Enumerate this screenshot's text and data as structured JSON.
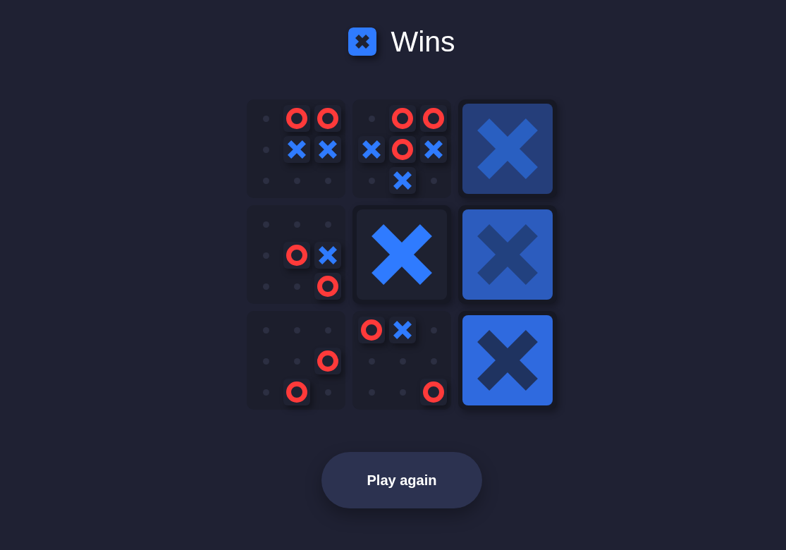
{
  "header": {
    "logo": {
      "kind": "x"
    },
    "title": "Wins"
  },
  "board": {
    "sub_boards": [
      {
        "kind": "open",
        "cells": [
          {
            "kind": "empty"
          },
          {
            "kind": "o"
          },
          {
            "kind": "o"
          },
          {
            "kind": "empty"
          },
          {
            "kind": "x"
          },
          {
            "kind": "x"
          },
          {
            "kind": "empty"
          },
          {
            "kind": "empty"
          },
          {
            "kind": "empty"
          }
        ]
      },
      {
        "kind": "open",
        "cells": [
          {
            "kind": "empty"
          },
          {
            "kind": "o"
          },
          {
            "kind": "o"
          },
          {
            "kind": "x"
          },
          {
            "kind": "o"
          },
          {
            "kind": "x"
          },
          {
            "kind": "empty"
          },
          {
            "kind": "x"
          },
          {
            "kind": "empty"
          }
        ]
      },
      {
        "kind": "won_by_x",
        "color": "#253e7a"
      },
      {
        "kind": "open",
        "cells": [
          {
            "kind": "empty"
          },
          {
            "kind": "empty"
          },
          {
            "kind": "empty"
          },
          {
            "kind": "empty"
          },
          {
            "kind": "o"
          },
          {
            "kind": "x"
          },
          {
            "kind": "empty"
          },
          {
            "kind": "empty"
          },
          {
            "kind": "o"
          }
        ]
      },
      {
        "kind": "won_by_x"
      },
      {
        "kind": "won_by_x",
        "color": "#2c5cbe"
      },
      {
        "kind": "open",
        "cells": [
          {
            "kind": "empty"
          },
          {
            "kind": "empty"
          },
          {
            "kind": "empty"
          },
          {
            "kind": "empty"
          },
          {
            "kind": "empty"
          },
          {
            "kind": "o"
          },
          {
            "kind": "empty"
          },
          {
            "kind": "o"
          },
          {
            "kind": "empty"
          }
        ]
      },
      {
        "kind": "open",
        "cells": [
          {
            "kind": "o"
          },
          {
            "kind": "x"
          },
          {
            "kind": "empty"
          },
          {
            "kind": "empty"
          },
          {
            "kind": "empty"
          },
          {
            "kind": "empty"
          },
          {
            "kind": "empty"
          },
          {
            "kind": "empty"
          },
          {
            "kind": "o"
          }
        ]
      },
      {
        "kind": "won_by_x",
        "color": "#2f6adf"
      }
    ]
  },
  "play_again_button": {
    "label": "Play again"
  }
}
